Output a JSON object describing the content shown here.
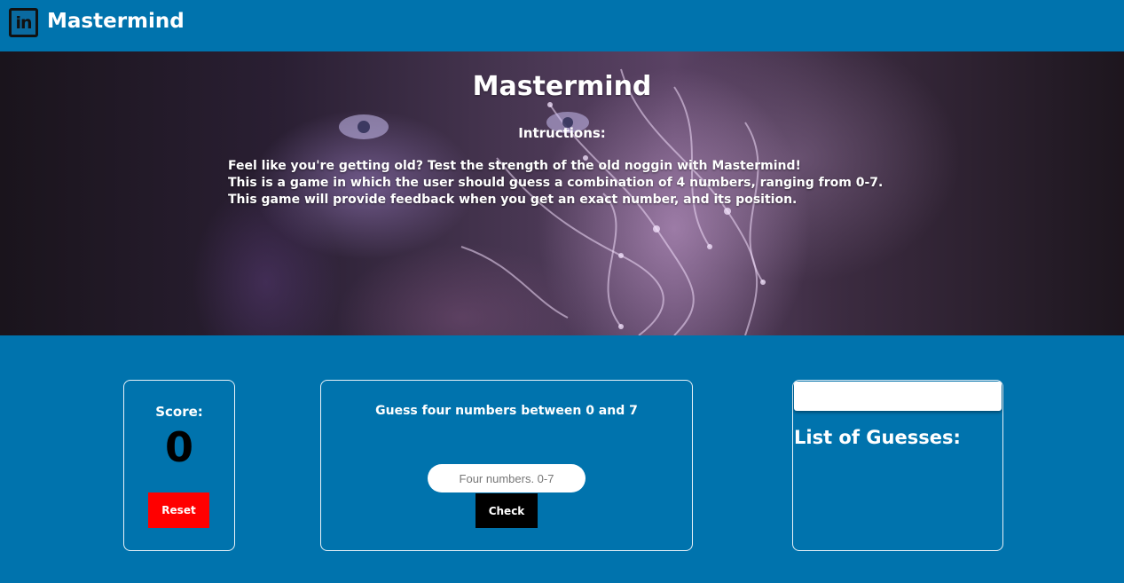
{
  "nav": {
    "logo_text": "in",
    "brand": "Mastermind"
  },
  "hero": {
    "title": "Mastermind",
    "subtitle": "Intructions:",
    "lines": [
      "Feel like you're getting old? Test the strength of the old noggin with Mastermind!",
      "This is a game in which the user should guess a combination of 4 numbers, ranging from 0-7.",
      "This game will provide feedback when you get an exact number, and its position."
    ]
  },
  "score": {
    "label": "Score:",
    "value": "0",
    "reset_label": "Reset"
  },
  "guess": {
    "title": "Guess four numbers between 0 and 7",
    "input_placeholder": "Four numbers. 0-7",
    "input_value": "",
    "check_label": "Check"
  },
  "guesses": {
    "title": "List of Guesses:",
    "items": []
  },
  "colors": {
    "background": "#0073ad",
    "reset_button": "#ff0000",
    "check_button": "#000000"
  }
}
